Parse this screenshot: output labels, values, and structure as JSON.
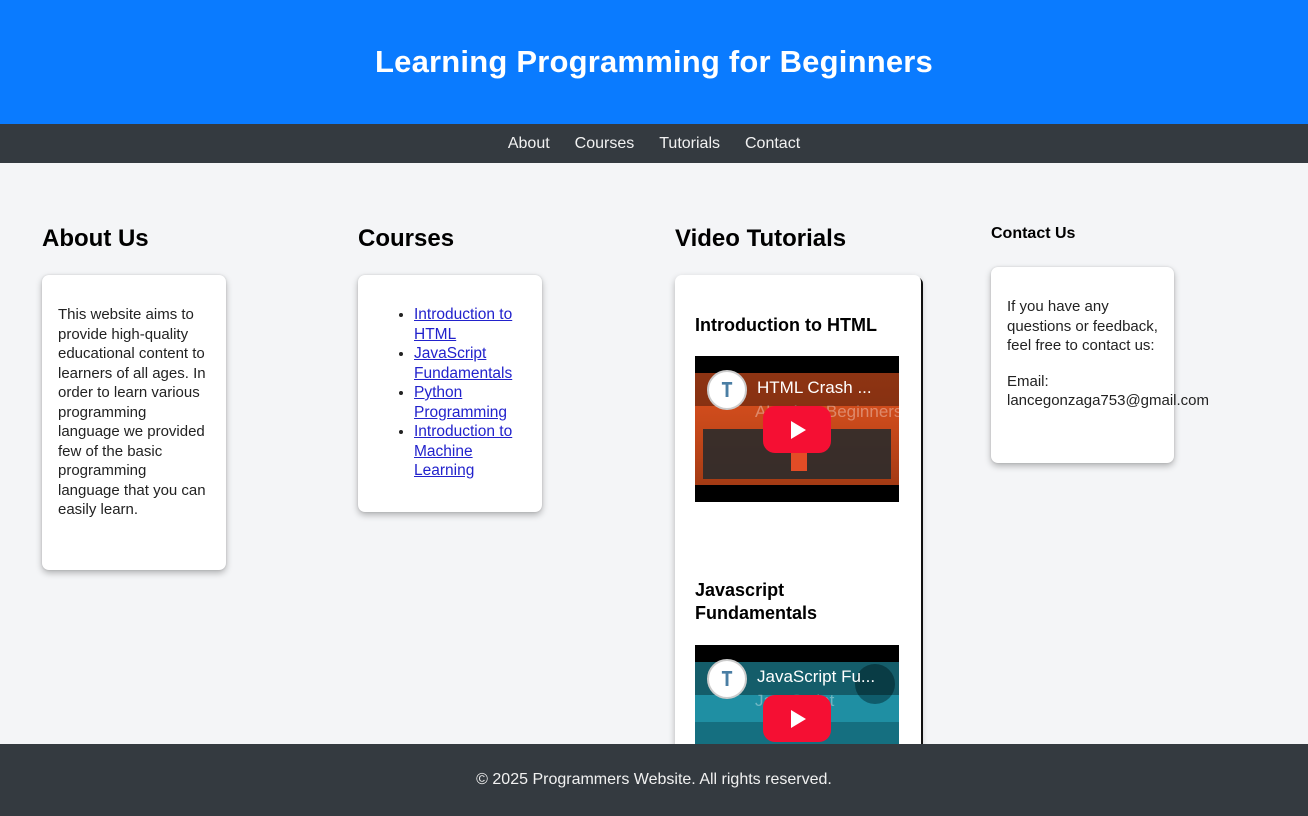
{
  "header": {
    "title": "Learning Programming for Beginners"
  },
  "nav": {
    "items": [
      "About",
      "Courses",
      "Tutorials",
      "Contact"
    ]
  },
  "about": {
    "title": "About Us",
    "text": "This website aims to provide high-quality educational content to learners of all ages. In order to learn various programming language we provided few of the basic programming language that you can easily learn."
  },
  "courses": {
    "title": "Courses",
    "items": [
      "Introduction to HTML",
      "JavaScript Fundamentals",
      "Python Programming",
      "Introduction to Machine Learning"
    ]
  },
  "videos": {
    "title": "Video Tutorials",
    "items": [
      {
        "heading": "Introduction to HTML",
        "label": "HTML Crash ...",
        "watermark": "Absolute Beginners"
      },
      {
        "heading": "Javascript Fundamentals",
        "label": "JavaScript Fu...",
        "watermark": "JavaScript"
      }
    ]
  },
  "contact": {
    "title": "Contact Us",
    "intro": "If you have any questions or feedback, feel free to contact us:",
    "email_label": "Email:",
    "email": "lancegonzaga753@gmail.com"
  },
  "footer": {
    "text": "© 2025 Programmers Website. All rights reserved."
  },
  "colors": {
    "header": "#0a7bff",
    "nav": "#343a40",
    "footer": "#343a40",
    "play": "#f50f33"
  }
}
